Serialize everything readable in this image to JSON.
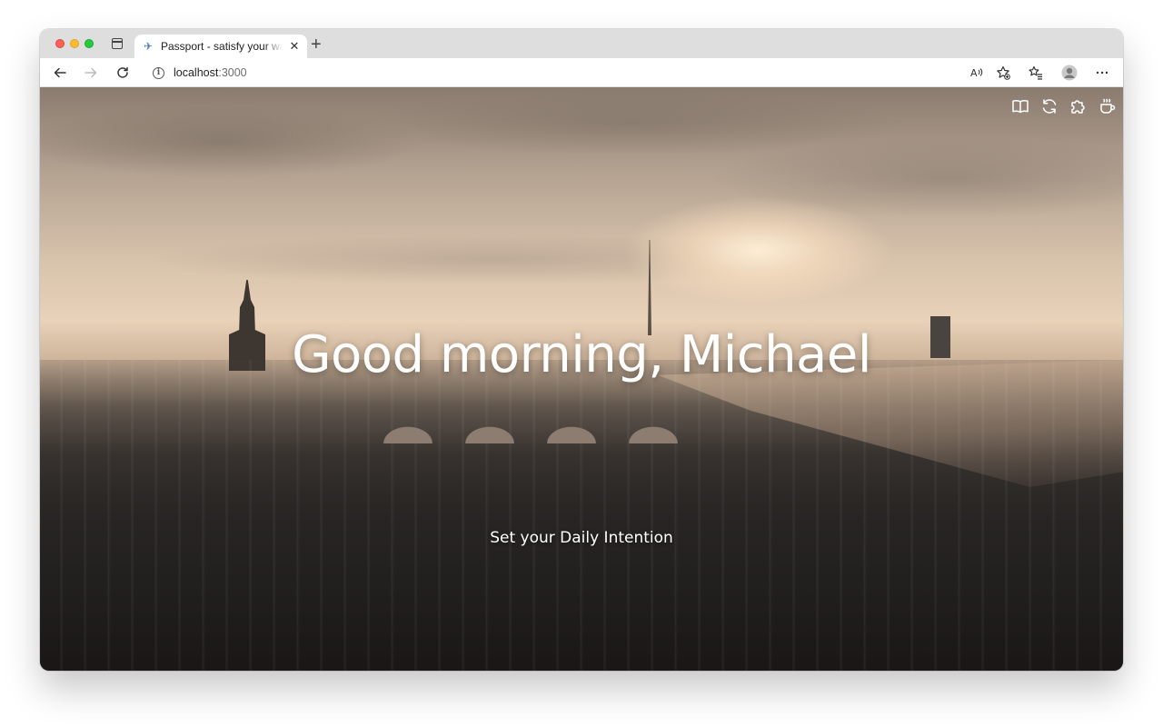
{
  "browser": {
    "tab": {
      "favicon": "airplane-icon",
      "title": "Passport - satisfy your wanderlust",
      "close_glyph": "✕"
    },
    "new_tab_glyph": "+",
    "address": {
      "host": "localhost",
      "port": ":3000"
    },
    "toolbar_icons": [
      "back-icon",
      "forward-icon",
      "reload-icon",
      "read-aloud-icon",
      "add-favorite-icon",
      "favorites-icon",
      "profile-icon",
      "more-icon"
    ]
  },
  "page": {
    "top_icons": [
      "book-icon",
      "refresh-icon",
      "puzzle-icon",
      "coffee-icon"
    ],
    "greeting": "Good morning, Michael",
    "intention_prompt": "Set your Daily Intention"
  }
}
